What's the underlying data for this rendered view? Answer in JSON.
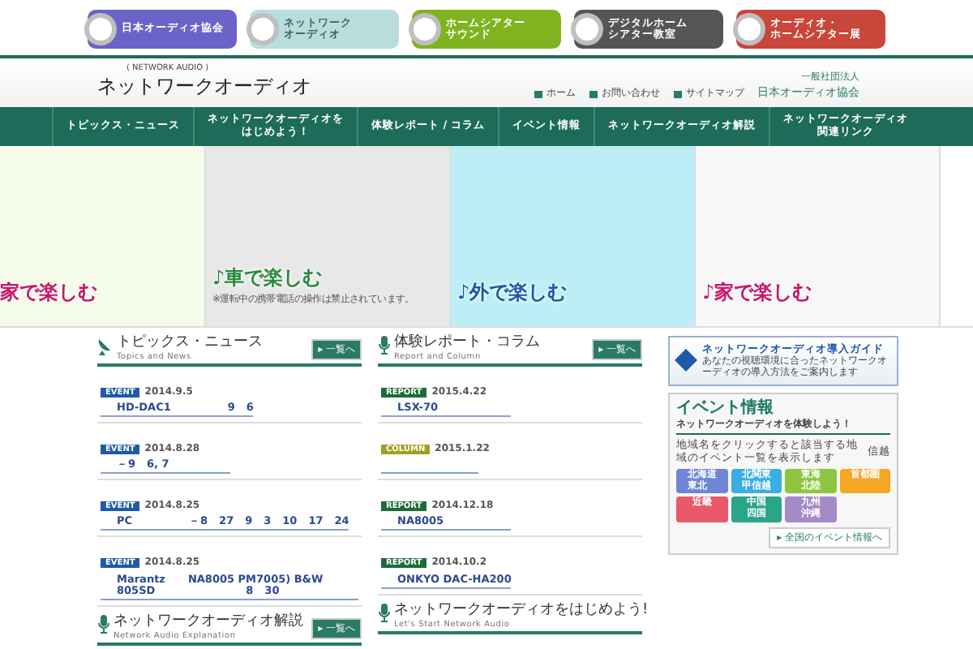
{
  "top_links": [
    {
      "lines": [
        "日本オーディオ協会"
      ],
      "color": "#6a63c8",
      "faded": false
    },
    {
      "lines": [
        "ネットワーク",
        "オーディオ"
      ],
      "color": "#b9dcdc",
      "faded": true
    },
    {
      "lines": [
        "ホームシアター",
        "サウンド"
      ],
      "color": "#7fb420",
      "faded": false
    },
    {
      "lines": [
        "デジタルホーム",
        "シアター教室"
      ],
      "color": "#555555",
      "faded": false
    },
    {
      "lines": [
        "オーディオ・",
        "ホームシアター展"
      ],
      "color": "#c8463a",
      "faded": false
    }
  ],
  "header": {
    "subtitle": "( NETWORK AUDIO )",
    "title": "ネットワークオーディオ",
    "links": [
      "ホーム",
      "お問い合わせ",
      "サイトマップ"
    ],
    "org_small": "一般社団法人",
    "org": "日本オーディオ協会"
  },
  "nav": [
    {
      "lines": [
        "トピックス・ニュース"
      ]
    },
    {
      "lines": [
        "ネットワークオーディオを",
        "はじめよう！"
      ]
    },
    {
      "lines": [
        "体験レポート / コラム"
      ]
    },
    {
      "lines": [
        "イベント情報"
      ]
    },
    {
      "lines": [
        "ネットワークオーディオ解説"
      ]
    },
    {
      "lines": [
        "ネットワークオーディオ",
        "関連リンク"
      ]
    }
  ],
  "banners": [
    {
      "caption": "家で楽しむ",
      "color": "#c8186a"
    },
    {
      "caption": "♪車で楽しむ",
      "note": "※運転中の携帯電話の操作は禁止されています。",
      "color": "#2a8a3a"
    },
    {
      "caption": "♪外で楽しむ",
      "color": "#1a5aa8"
    },
    {
      "caption": "♪家で楽しむ",
      "color": "#c8186a"
    }
  ],
  "topics": {
    "title": "トピックス・ニュース",
    "subtitle": "Topics and News",
    "more": "▸ 一覧へ",
    "items": [
      {
        "tag": "EVENT",
        "kind": "event",
        "date": "2014.9.5",
        "text": "HD-DAC1　　　　　9　6"
      },
      {
        "tag": "EVENT",
        "kind": "event",
        "date": "2014.8.28",
        "text": "－9　6, 7"
      },
      {
        "tag": "EVENT",
        "kind": "event",
        "date": "2014.8.25",
        "text": "PC　　　　　－8　27　9　3　10　17　24"
      },
      {
        "tag": "EVENT",
        "kind": "event",
        "date": "2014.8.25",
        "text": "Marantz　　NA8005 PM7005) B&W 805SD　　　　　　　　8　30"
      }
    ]
  },
  "reports": {
    "title": "体験レポート・コラム",
    "subtitle": "Report and Column",
    "more": "▸ 一覧へ",
    "items": [
      {
        "tag": "REPORT",
        "kind": "report",
        "date": "2015.4.22",
        "text": "LSX-70"
      },
      {
        "tag": "COLUMN",
        "kind": "column",
        "date": "2015.1.22"
      },
      {
        "tag": "REPORT",
        "kind": "report",
        "date": "2014.12.18",
        "text": "NA8005"
      },
      {
        "tag": "REPORT",
        "kind": "report",
        "date": "2014.10.2",
        "text": "ONKYO DAC-HA200"
      }
    ]
  },
  "explanation": {
    "title": "ネットワークオーディオ解説",
    "subtitle": "Network Audio Explanation",
    "more": "▸ 一覧へ"
  },
  "start": {
    "title": "ネットワークオーディオをはじめよう!",
    "subtitle": "Let's Start Network Audio"
  },
  "guide": {
    "title": "ネットワークオーディオ導入ガイド",
    "text": "あなたの視聴環境に合ったネットワークオーディオの導入方法をご案内します"
  },
  "events": {
    "title": "イベント情報",
    "subtitle": "ネットワークオーディオを体験しよう！",
    "text": "地域名をクリックすると該当する地域のイベント一覧を表示します",
    "shinetsu": "信越",
    "regions": [
      {
        "lines": [
          "北海道",
          "東北"
        ],
        "color": "#6f86d6"
      },
      {
        "lines": [
          "北関東",
          "甲信越"
        ],
        "color": "#3aaee0"
      },
      {
        "lines": [
          "東海",
          "北陸"
        ],
        "color": "#8cc63e"
      },
      {
        "lines": [
          "首都圏"
        ],
        "color": "#f5a623"
      },
      {
        "lines": [
          "近畿"
        ],
        "color": "#e85a6a"
      },
      {
        "lines": [
          "中国",
          "四国"
        ],
        "color": "#2aa58a"
      },
      {
        "lines": [
          "九州",
          "沖縄"
        ],
        "color": "#a58ac8"
      }
    ],
    "all": "▸ 全国のイベント情報へ"
  }
}
